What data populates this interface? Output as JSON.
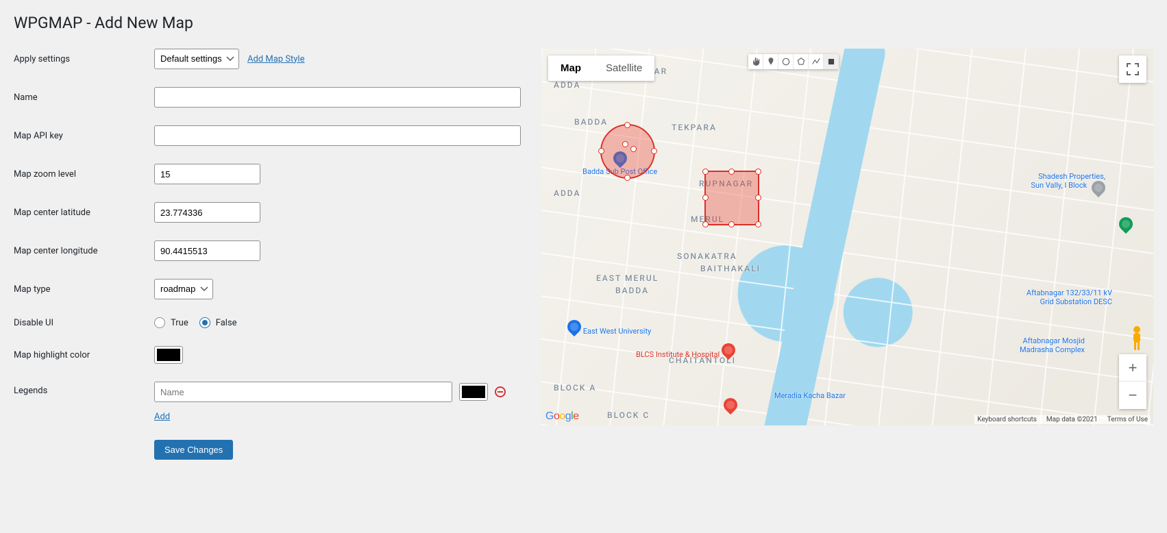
{
  "page": {
    "title": "WPGMAP - Add New Map"
  },
  "form": {
    "apply_settings": {
      "label": "Apply settings",
      "value": "Default settings",
      "add_style_link": "Add Map Style"
    },
    "name": {
      "label": "Name",
      "value": ""
    },
    "api_key": {
      "label": "Map API key",
      "value": ""
    },
    "zoom": {
      "label": "Map zoom level",
      "value": "15"
    },
    "lat": {
      "label": "Map center latitude",
      "value": "23.774336"
    },
    "lng": {
      "label": "Map center longitude",
      "value": "90.4415513"
    },
    "map_type": {
      "label": "Map type",
      "value": "roadmap"
    },
    "disable_ui": {
      "label": "Disable UI",
      "true_label": "True",
      "false_label": "False",
      "value": "false"
    },
    "highlight": {
      "label": "Map highlight color",
      "value": "#000000"
    },
    "legends": {
      "label": "Legends",
      "placeholder": "Name",
      "item_color": "#000000",
      "add_link": "Add"
    },
    "save_button": "Save Changes"
  },
  "map_ui": {
    "type_map": "Map",
    "type_sat": "Satellite",
    "footer_keyboard": "Keyboard shortcuts",
    "footer_data": "Map data ©2021",
    "footer_terms": "Terms of Use"
  },
  "map_labels": {
    "adarsha": "ADARSHA NAGAR",
    "adda": "ADDA",
    "badda": "BADDA",
    "tekpara": "TEKPARA",
    "rupnagar": "RUPNAGAR",
    "merul": "MERUL",
    "sonakatra": "SONAKATRA",
    "baithakali": "BAITHAKALI",
    "east_merul": "EAST MERUL",
    "east_badda": "BADDA",
    "chaintantoli": "CHAITANTOLI",
    "block_a": "BLOCK A",
    "block_c": "BLOCK C",
    "adda2": "ADDA"
  },
  "map_pois": {
    "post_office": "Badda Sub Post Office",
    "shadesh": "Shadesh Properties,\nSun Vally, I Block",
    "aftab_sub": "Aftabnagar 132/33/11 kV\nGrid Substation DESC",
    "ewu": "East West University",
    "blcs": "BLCS Institute & Hospital",
    "mosjid": "Aftabnagar Mosjid\nMadrasha Complex",
    "meradia": "Meradia Kacha Bazar"
  }
}
